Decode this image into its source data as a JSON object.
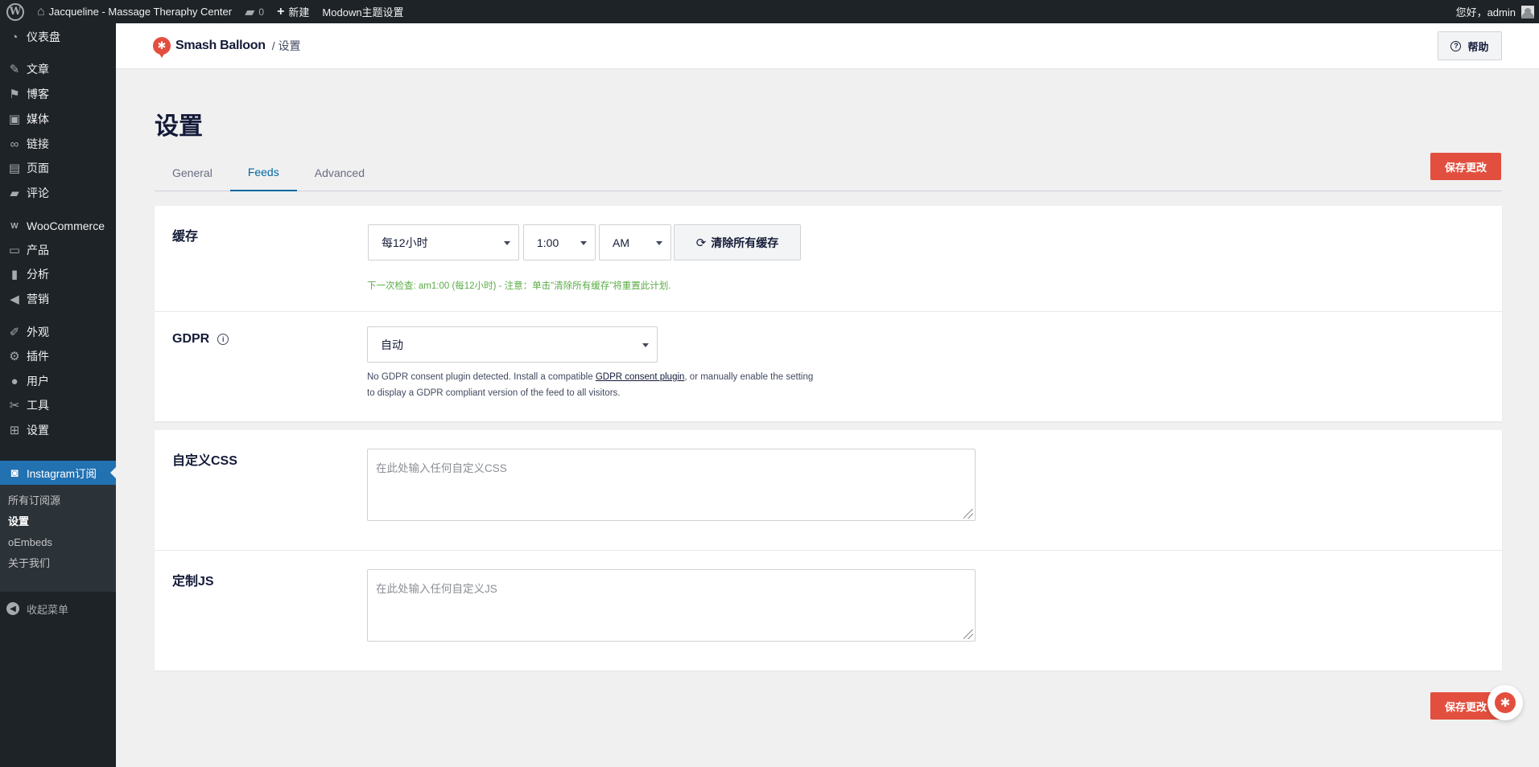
{
  "adminbar": {
    "site_name": "Jacqueline - Massage Theraphy Center",
    "comments_count": "0",
    "new_label": "新建",
    "theme_settings": "Modown主题设置",
    "greeting": "您好，admin"
  },
  "sidebar": {
    "items": [
      {
        "label": "仪表盘",
        "icon": "dashboard-icon"
      },
      {
        "label": "文章",
        "icon": "pin-icon"
      },
      {
        "label": "博客",
        "icon": "flag-icon"
      },
      {
        "label": "媒体",
        "icon": "media-icon"
      },
      {
        "label": "链接",
        "icon": "link-icon"
      },
      {
        "label": "页面",
        "icon": "page-icon"
      },
      {
        "label": "评论",
        "icon": "comment-icon"
      },
      {
        "label": "WooCommerce",
        "icon": "woo-icon"
      },
      {
        "label": "产品",
        "icon": "archive-icon"
      },
      {
        "label": "分析",
        "icon": "chart-icon"
      },
      {
        "label": "营销",
        "icon": "megaphone-icon"
      },
      {
        "label": "外观",
        "icon": "brush-icon"
      },
      {
        "label": "插件",
        "icon": "plugin-icon"
      },
      {
        "label": "用户",
        "icon": "user-icon"
      },
      {
        "label": "工具",
        "icon": "wrench-icon"
      },
      {
        "label": "设置",
        "icon": "settings-icon"
      },
      {
        "label": "Instagram订阅",
        "icon": "camera-icon"
      }
    ],
    "submenu": [
      "所有订阅源",
      "设置",
      "oEmbeds",
      "关于我们"
    ],
    "collapse_label": "收起菜单"
  },
  "header": {
    "brand": "Smash Balloon",
    "breadcrumb": "/ 设置",
    "help_label": "帮助"
  },
  "page": {
    "title": "设置",
    "tabs": [
      "General",
      "Feeds",
      "Advanced"
    ],
    "active_tab": "Feeds",
    "save_label": "保存更改"
  },
  "cache": {
    "label": "缓存",
    "interval": "每12小时",
    "time": "1:00",
    "ampm": "AM",
    "clear_label": "清除所有缓存",
    "note": "下一次检查: am1:00 (每12小时) - 注意：单击\"清除所有缓存\"将重置此计划."
  },
  "gdpr": {
    "label": "GDPR",
    "value": "自动",
    "help_before": "No GDPR consent plugin detected. Install a compatible ",
    "help_link": "GDPR consent plugin",
    "help_after": ", or manually enable the setting to display a GDPR compliant version of the feed to all visitors."
  },
  "custom_css": {
    "label": "自定义CSS",
    "placeholder": "在此处输入任何自定义CSS"
  },
  "custom_js": {
    "label": "定制JS",
    "placeholder": "在此处输入任何自定义JS"
  },
  "colors": {
    "accent": "#e34f3e",
    "tab_active": "#0068a0",
    "note_green": "#59ab46",
    "admin_dark": "#1d2327",
    "menu_active": "#2271b1"
  }
}
